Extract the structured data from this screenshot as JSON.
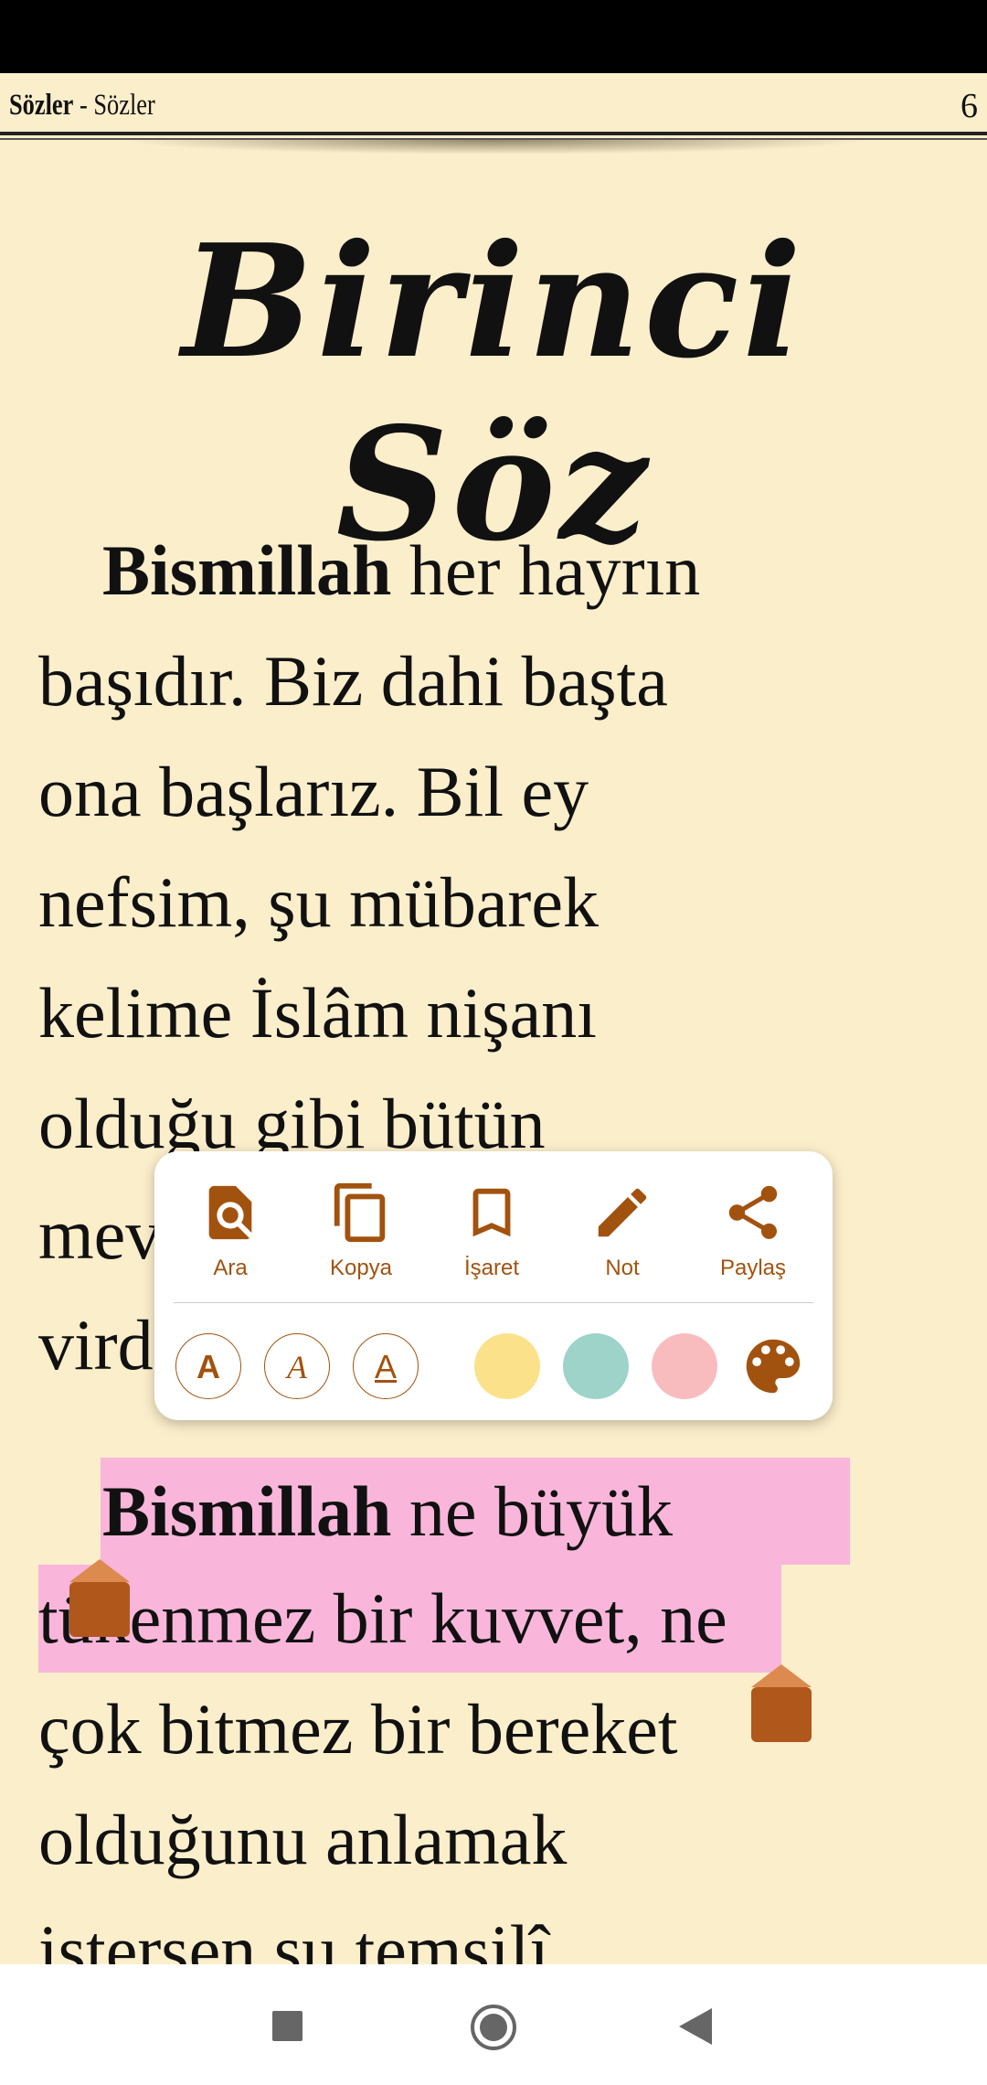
{
  "header": {
    "book": "Sözler",
    "separator": " - ",
    "section": "Sözler",
    "page": "6"
  },
  "title": "Birinci Söz",
  "paragraph1": {
    "bold": "Bismillah",
    "lines": [
      " her hayrın",
      "başıdır. Biz dahi başta",
      "ona başlarız. Bil ey",
      "nefsim, şu mübarek",
      "kelime İslâm nişanı",
      "olduğu gibi bütün",
      "mevcudatın lisan-ı hâliyle",
      "virdidir."
    ]
  },
  "paragraph2": {
    "bold": "Bismillah",
    "lines": [
      " ne büyük",
      "tükenmez bir kuvvet, ne",
      "çok bitmez bir bereket",
      "olduğunu anlamak",
      "istersen şu temsilî"
    ]
  },
  "selection": {
    "color": "#f9b6da",
    "handle_color": "#b0571c"
  },
  "popup": {
    "actions": [
      {
        "label": "Ara",
        "icon": "find-in-page-icon"
      },
      {
        "label": "Kopya",
        "icon": "copy-icon"
      },
      {
        "label": "İşaret",
        "icon": "bookmark-icon"
      },
      {
        "label": "Not",
        "icon": "pencil-icon"
      },
      {
        "label": "Paylaş",
        "icon": "share-icon"
      }
    ],
    "formats": [
      {
        "label": "A",
        "style": "bold"
      },
      {
        "label": "A",
        "style": "italic"
      },
      {
        "label": "A",
        "style": "underline"
      }
    ],
    "colors": [
      "#fbe28a",
      "#9dd3c9",
      "#f9bcbe"
    ],
    "accent": "#a2520f"
  }
}
